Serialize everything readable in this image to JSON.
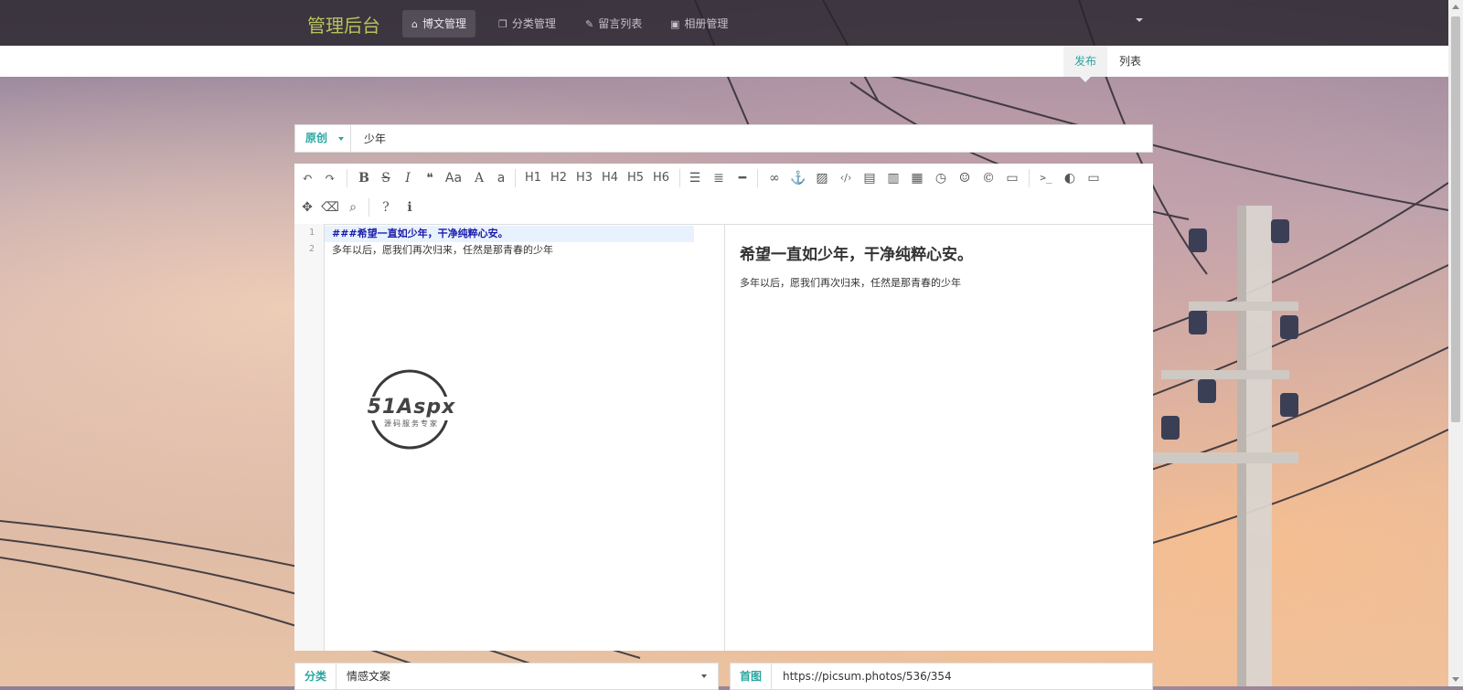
{
  "app": {
    "brand": "管理后台"
  },
  "nav": {
    "items": [
      {
        "label": "博文管理",
        "icon": "home-icon"
      },
      {
        "label": "分类管理",
        "icon": "copy-icon"
      },
      {
        "label": "留言列表",
        "icon": "pencil-icon"
      },
      {
        "label": "相册管理",
        "icon": "picture-icon"
      }
    ],
    "active_index": 0
  },
  "subnav": {
    "tabs": [
      {
        "label": "发布"
      },
      {
        "label": "列表"
      }
    ],
    "active_index": 0
  },
  "post": {
    "type_label": "原创",
    "title": "少年",
    "category_label": "分类",
    "category_value": "情感文案",
    "cover_label": "首图",
    "cover_value": "https://picsum.photos/536/354"
  },
  "editor": {
    "toolbar_icons": [
      "undo",
      "redo",
      "bold",
      "strikethrough",
      "italic",
      "quote",
      "uppercase",
      "ucwords",
      "lowercase",
      "h1",
      "h2",
      "h3",
      "h4",
      "h5",
      "h6",
      "unordered-list",
      "ordered-list",
      "hr",
      "link",
      "anchor",
      "image",
      "code",
      "preformatted-code",
      "code-block",
      "table",
      "datetime",
      "emoji",
      "html-entities",
      "pagebreak",
      "goto-line",
      "watch",
      "preview",
      "fullscreen",
      "clear",
      "search",
      "help",
      "info"
    ],
    "headings": [
      "H1",
      "H2",
      "H3",
      "H4",
      "H5",
      "H6"
    ],
    "glyphs": {
      "bold": "B",
      "strike": "S",
      "italic": "I",
      "quote": "❝",
      "upper": "Aa",
      "ucw": "A",
      "lower": "a"
    },
    "lines": [
      {
        "num": "1",
        "text": "###希望一直如少年，干净纯粹心安。"
      },
      {
        "num": "2",
        "text": "多年以后，愿我们再次归来，任然是那青春的少年"
      }
    ],
    "preview_heading": "希望一直如少年，干净纯粹心安。",
    "preview_paragraph": "多年以后，愿我们再次归来，任然是那青春的少年"
  },
  "watermark": {
    "brand": "51Aspx",
    "tagline": "源码服务专家"
  },
  "colors": {
    "accent": "#2aa6a0",
    "brand": "#b8c25b",
    "nav_bg": "#28242c"
  }
}
